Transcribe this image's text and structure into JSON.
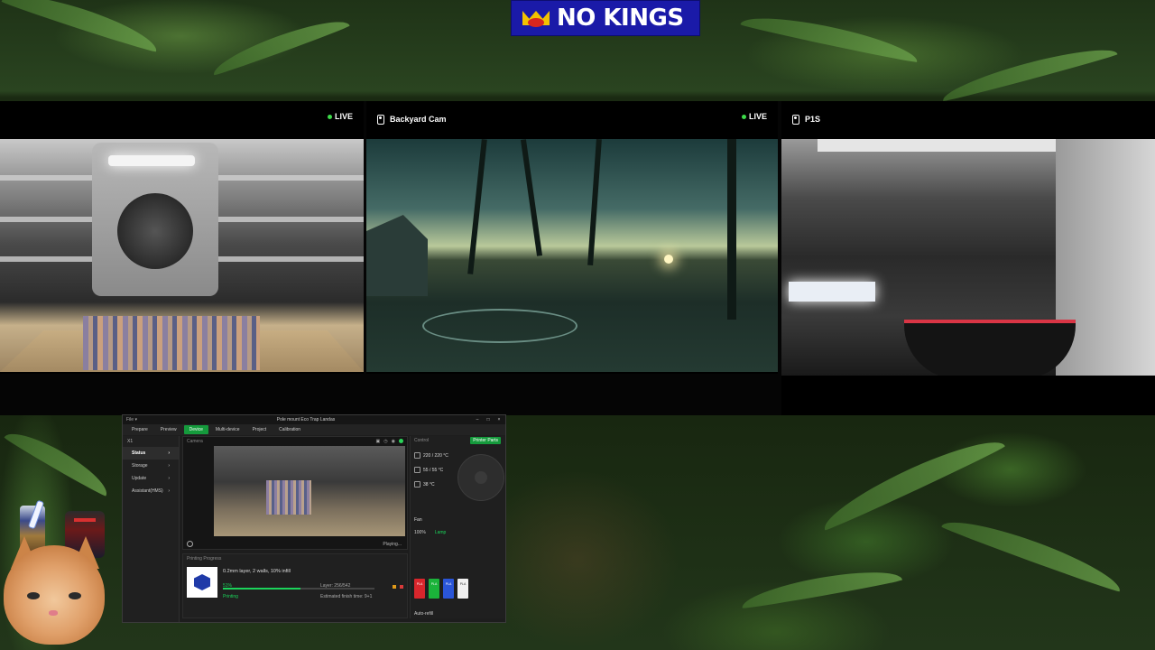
{
  "banner": {
    "text": "NO KINGS"
  },
  "cameras": [
    {
      "title": "",
      "live_label": "LIVE",
      "show_live": true
    },
    {
      "title": "Backyard Cam",
      "live_label": "LIVE",
      "show_live": true
    },
    {
      "title": "P1S",
      "live_label": "",
      "show_live": false
    }
  ],
  "app": {
    "window_title": "Pole mount Eco Trap Landas",
    "nav": [
      {
        "label": "Prepare",
        "active": false
      },
      {
        "label": "Preview",
        "active": false
      },
      {
        "label": "Device",
        "active": true
      },
      {
        "label": "Multi-device",
        "active": false
      },
      {
        "label": "Project",
        "active": false
      },
      {
        "label": "Calibration",
        "active": false
      }
    ],
    "device": "X1",
    "sidebar": [
      {
        "label": "Status",
        "selected": true
      },
      {
        "label": "Storage",
        "selected": false
      },
      {
        "label": "Update",
        "selected": false
      },
      {
        "label": "Assistant(HMS)",
        "selected": false
      }
    ],
    "camera": {
      "label": "Camera",
      "state": "Playing..."
    },
    "progress": {
      "section": "Printing Progress",
      "job": "0.2mm layer, 2 walls, 10% infill",
      "percent": 51,
      "percent_label": "51%",
      "layer": "Layer: 256/542",
      "state": "Printing",
      "eta": "Estimated finish time: 9+1"
    },
    "control": {
      "header": "Control",
      "parts_button": "Printer Parts",
      "temps": [
        "220 / 220 °C",
        "55 / 55 °C",
        "38 °C"
      ],
      "fan_label": "Fan",
      "fan_pct": "100%",
      "lamp_label": "Lamp",
      "auto_refill": "Auto-refill",
      "ams": [
        {
          "label": "PLA",
          "color": "#d9262c"
        },
        {
          "label": "PLA",
          "color": "#1bb33a"
        },
        {
          "label": "PLA",
          "color": "#2a55d8"
        },
        {
          "label": "PLA",
          "color": "#f0f0f0"
        }
      ]
    }
  }
}
